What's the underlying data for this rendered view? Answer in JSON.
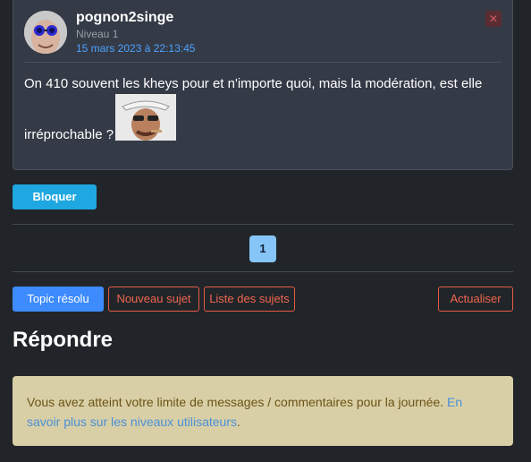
{
  "post": {
    "username": "pognon2singe",
    "level": "Niveau 1",
    "date": "15 mars 2023 à 22:13:45",
    "close_glyph": "✕",
    "message_line1": "On 410 souvent les kheys pour et n'importe quoi, mais la modération, est elle",
    "message_line2": "irréprochable ?"
  },
  "actions": {
    "block_label": "Bloquer"
  },
  "pagination": {
    "current_page": "1"
  },
  "toolbar": {
    "resolved_label": "Topic résolu",
    "new_topic_label": "Nouveau sujet",
    "topic_list_label": "Liste des sujets",
    "refresh_label": "Actualiser"
  },
  "reply": {
    "heading": "Répondre",
    "alert_text": "Vous avez atteint votre limite de messages / commentaires pour la journée. ",
    "alert_link": "En savoir plus sur les niveaux utilisateurs",
    "alert_end": "."
  },
  "colors": {
    "background": "#212529",
    "card": "#343a46",
    "accent_blue": "#1ea7e0",
    "danger_outline": "#e55a44",
    "alert_bg": "#d9cfa6"
  }
}
